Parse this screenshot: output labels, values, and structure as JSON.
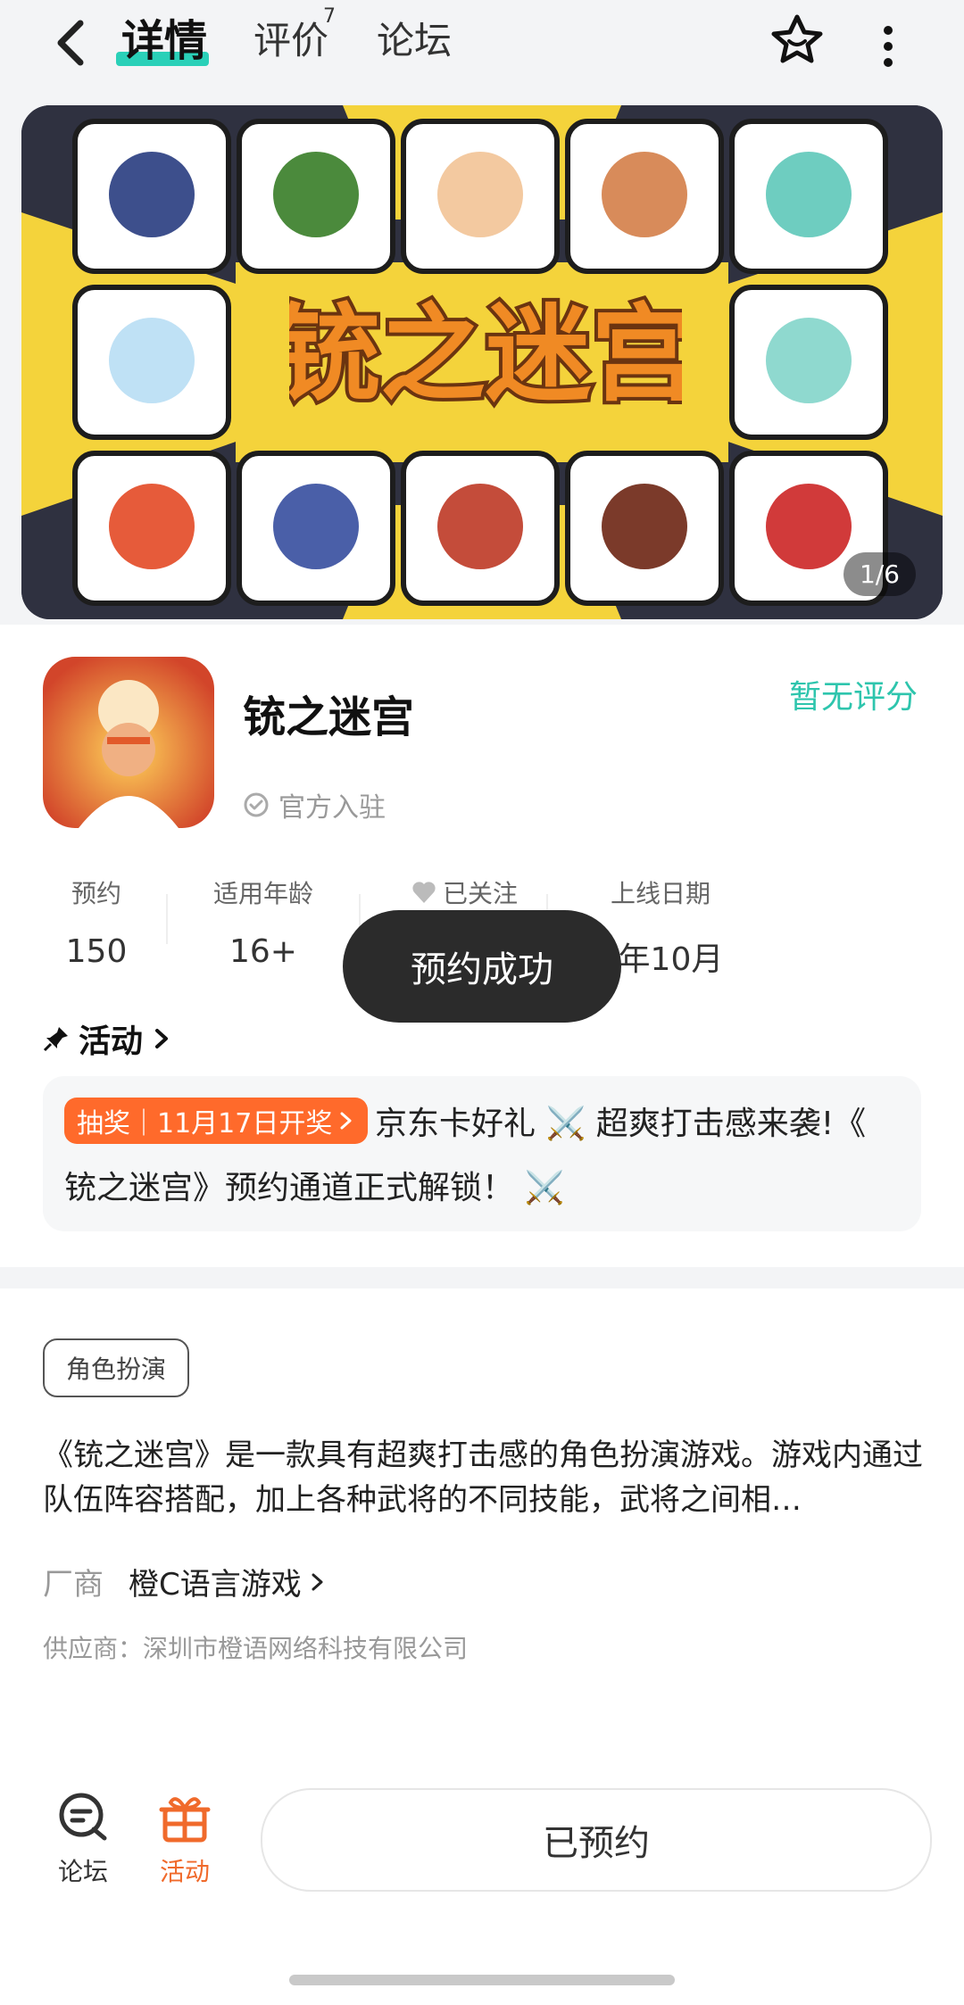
{
  "header": {
    "tabs": [
      {
        "label": "详情"
      },
      {
        "label": "评价"
      },
      {
        "label": "论坛"
      }
    ],
    "review_count": "7"
  },
  "banner": {
    "title": "铳之迷宫",
    "pager": "1/6"
  },
  "app": {
    "name": "铳之迷宫",
    "official": "官方入驻",
    "rating": "暂无评分"
  },
  "stats": [
    {
      "label": "预约",
      "value": "150"
    },
    {
      "label": "适用年龄",
      "value": "16+"
    },
    {
      "label": "已关注",
      "value": ""
    },
    {
      "label": "上线日期",
      "value": "5年10月"
    }
  ],
  "toast": "预约成功",
  "activity": {
    "title": "活动",
    "chip": "抽奖｜11月17日开奖",
    "line1": "京东卡好礼 ⚔️ 超爽打击感来袭!《",
    "line2": "铳之迷宫》预约通道正式解锁！ ⚔️"
  },
  "details": {
    "tag": "角色扮演",
    "description": "《铳之迷宫》是一款具有超爽打击感的角色扮演游戏。游戏内通过队伍阵容搭配，加上各种武将的不同技能，武将之间相…",
    "vendor_label": "厂商",
    "vendor_name": "橙C语言游戏",
    "supplier": "供应商：深圳市橙语网络科技有限公司"
  },
  "bottom": {
    "nav": [
      {
        "label": "论坛"
      },
      {
        "label": "活动"
      }
    ],
    "reserve_label": "已预约"
  },
  "colors": {
    "accent": "#2ec5ad",
    "highlight": "#2ad0b8",
    "promo": "#ff6a2b",
    "active_nav": "#f06a2b"
  }
}
